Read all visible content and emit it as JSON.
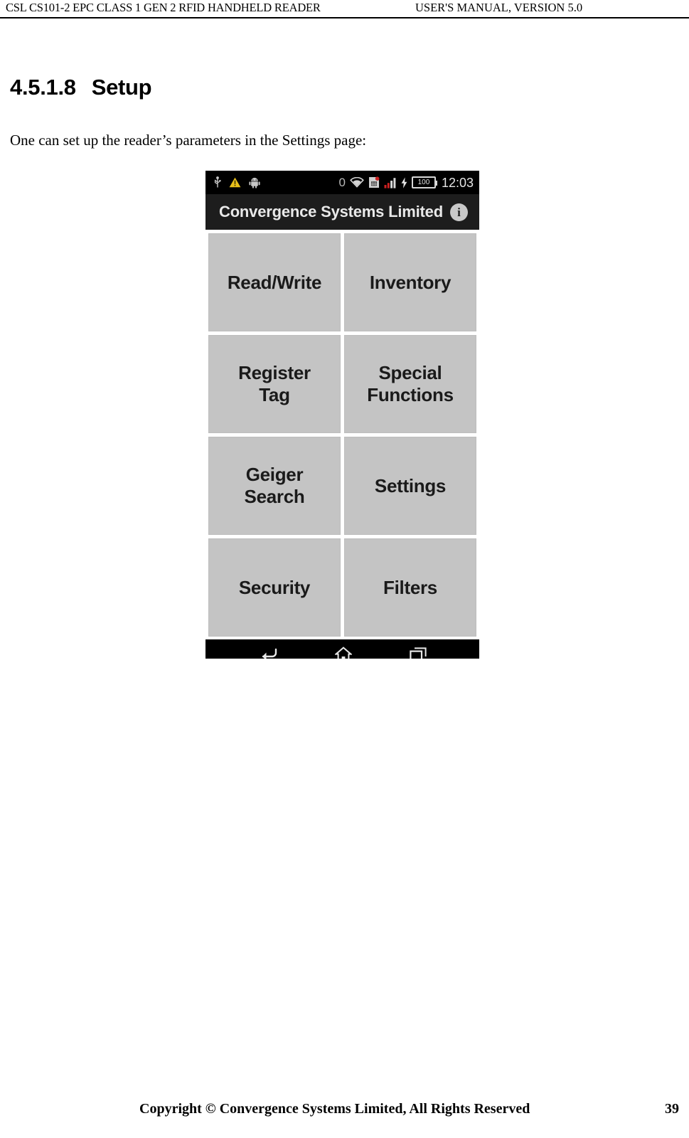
{
  "header": {
    "left_text": "CSL CS101-2 EPC CLASS 1 GEN 2 RFID HANDHELD READER",
    "right_text": "USER'S  MANUAL,  VERSION  5.0"
  },
  "section": {
    "number": "4.5.1.8",
    "title": "Setup",
    "paragraph": "One can set up the reader’s parameters in the Settings page:"
  },
  "phone": {
    "status_bar": {
      "icons_left": [
        "usb-icon",
        "warning-triangle-icon",
        "android-robot-icon"
      ],
      "zero_label": "0",
      "icons_right": [
        "wifi-icon",
        "sim-card-icon",
        "signal-bars-icon",
        "charging-bolt-icon"
      ],
      "battery_level": "100",
      "clock": "12:03"
    },
    "app_bar": {
      "title": "Convergence Systems Limited",
      "info_label": "i",
      "info_icon": "info-circle-icon"
    },
    "menu_buttons": [
      {
        "label": "Read/Write",
        "name": "read-write"
      },
      {
        "label": "Inventory",
        "name": "inventory"
      },
      {
        "label": "Register\nTag",
        "name": "register-tag"
      },
      {
        "label": "Special\nFunctions",
        "name": "special-functions"
      },
      {
        "label": "Geiger\nSearch",
        "name": "geiger-search"
      },
      {
        "label": "Settings",
        "name": "settings"
      },
      {
        "label": "Security",
        "name": "security"
      },
      {
        "label": "Filters",
        "name": "filters"
      }
    ],
    "nav_bar": {
      "back_icon": "back-arrow-icon",
      "home_icon": "home-icon",
      "recents_icon": "recent-apps-icon"
    }
  },
  "footer": {
    "copyright": "Copyright © Convergence Systems Limited, All Rights Reserved",
    "page_number": "39"
  },
  "colors": {
    "status_bar_bg": "#000000",
    "app_bar_bg": "#1d1d1d",
    "button_bg": "#c4c4c4",
    "warning_yellow": "#e8c01a",
    "signal_red": "#cc2222"
  }
}
